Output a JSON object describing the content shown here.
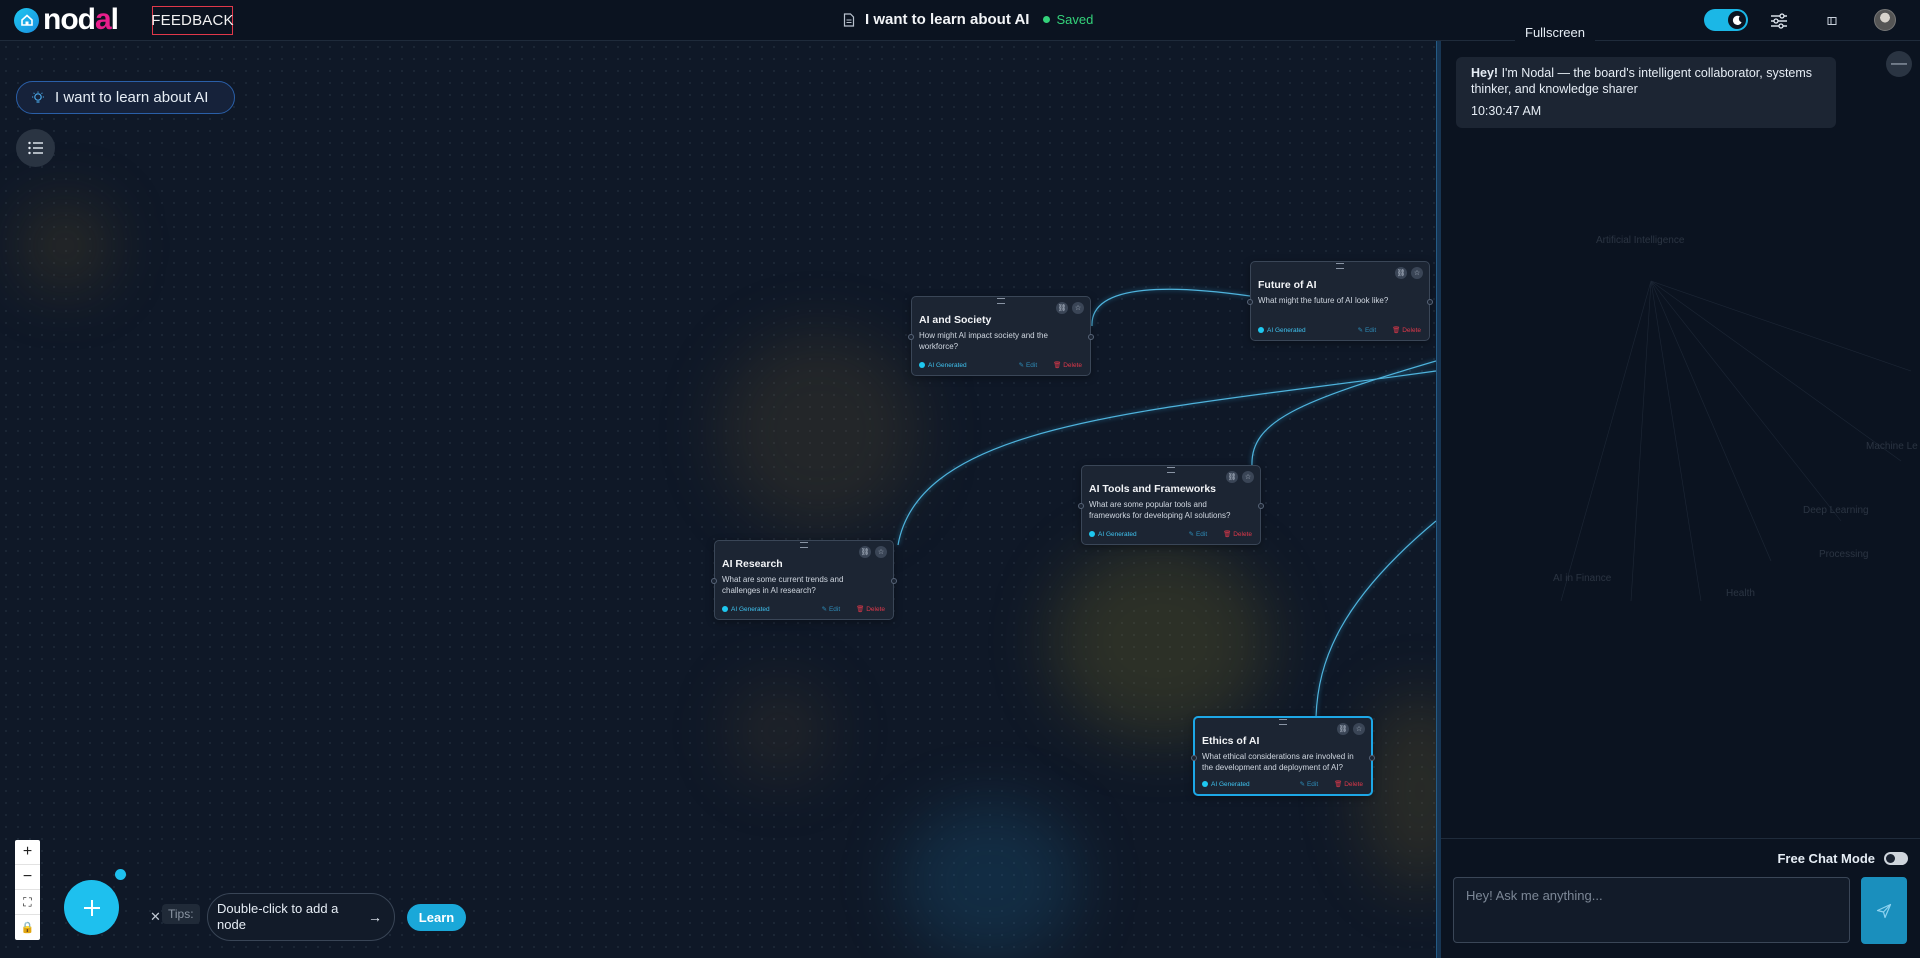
{
  "topbar": {
    "logo_text": "nodal",
    "feedback_label": "FEEDBACK",
    "doc_title": "I want to learn about AI",
    "save_status": "Saved",
    "fullscreen_tooltip": "Fullscreen",
    "status_color": "#34d27a",
    "accent_color": "#1ec0ee"
  },
  "canvas": {
    "topic_pill": "I want to learn about AI",
    "nodes": [
      {
        "title": "AI and Society",
        "description": "How might AI impact society and the workforce?",
        "badge": "AI Generated",
        "edit": "Edit",
        "delete": "Delete"
      },
      {
        "title": "Future of AI",
        "description": "What might the future of AI look like?",
        "badge": "AI Generated",
        "edit": "Edit",
        "delete": "Delete"
      },
      {
        "title": "AI Tools and Frameworks",
        "description": "What are some popular tools and frameworks for developing AI solutions?",
        "badge": "AI Generated",
        "edit": "Edit",
        "delete": "Delete"
      },
      {
        "title": "AI Research",
        "description": "What are some current trends and challenges in AI research?",
        "badge": "AI Generated",
        "edit": "Edit",
        "delete": "Delete"
      },
      {
        "title": "Ethics of AI",
        "description": "What ethical considerations are involved in the development and deployment of AI?",
        "badge": "AI Generated",
        "edit": "Edit",
        "delete": "Delete"
      }
    ],
    "tips": {
      "label": "Tips:",
      "text": "Double-click to add a node",
      "learn_label": "Learn"
    },
    "zoom_controls": [
      "+",
      "−",
      "⛶",
      "🔒"
    ]
  },
  "chat": {
    "greeting_bold": "Hey!",
    "greeting_text": " I'm Nodal — the board's intelligent collaborator, systems thinker, and knowledge sharer",
    "timestamp": "10:30:47 AM",
    "ghost_labels": [
      "Artificial Intelligence",
      "Machine Le",
      "Deep Learning",
      "Processing",
      "AI in Finance",
      "Health"
    ],
    "free_chat_label": "Free Chat Mode",
    "input_placeholder": "Hey! Ask me anything..."
  }
}
